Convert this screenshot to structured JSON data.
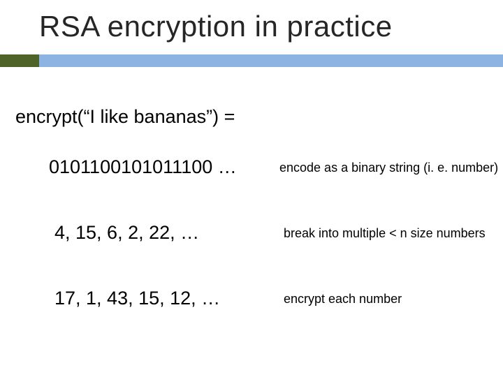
{
  "title": "RSA encryption in practice",
  "expression": "encrypt(“I like bananas”) =",
  "rows": [
    {
      "left": "0101100101011100 …",
      "right": "encode as a binary string (i. e. number)"
    },
    {
      "left": "4, 15, 6, 2, 22, …",
      "right": "break into multiple < n size numbers"
    },
    {
      "left": "17, 1, 43, 15, 12, …",
      "right": "encrypt each number"
    }
  ]
}
